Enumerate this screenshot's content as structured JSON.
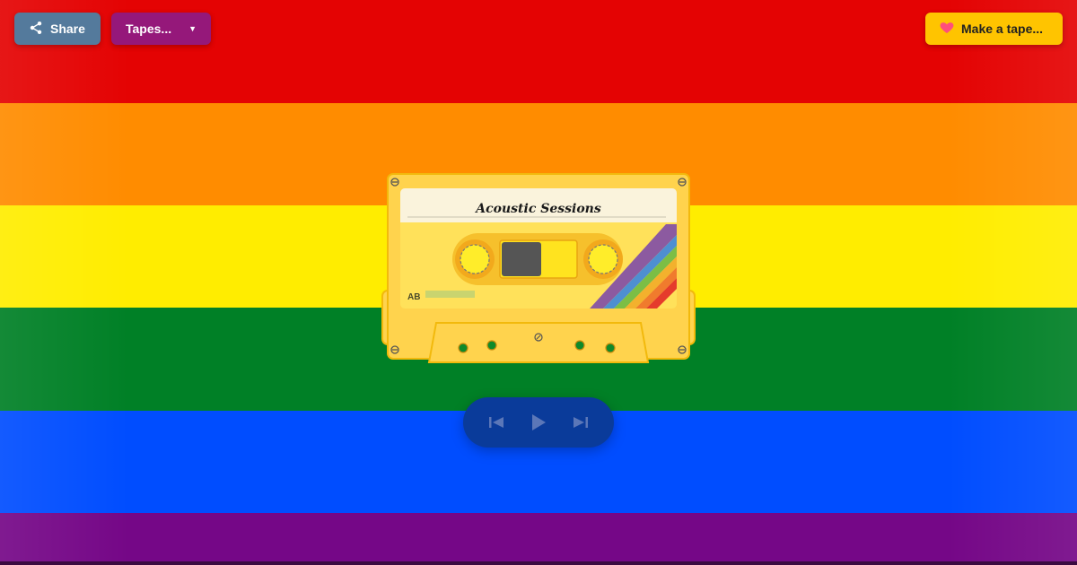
{
  "background": {
    "stripe_colors": [
      "#e40303",
      "#ff8c00",
      "#ffed00",
      "#008026",
      "#004dff",
      "#750787"
    ]
  },
  "header": {
    "share_label": "Share",
    "tapes_label": "Tapes...",
    "make_tape_label": "Make a tape..."
  },
  "colors": {
    "share_bg": "#547a9c",
    "tapes_bg": "#95187a",
    "make_bg": "#ffc400",
    "heart": "#ff4f7b",
    "cassette_body": "#ffd34d",
    "cassette_edge": "#f2b90c",
    "label_paper": "#faf3dc",
    "controls_bg": "#0a3b9a",
    "controls_icon": "#5b77b8"
  },
  "cassette": {
    "title": "Acoustic Sessions",
    "side_label": "AB",
    "rainbow_colors": [
      "#e53b2c",
      "#f07b2d",
      "#f3b12d",
      "#7cbe45",
      "#4e8fd1",
      "#8c5aa0"
    ]
  },
  "icons": {
    "share": "share-icon",
    "tapes_caret": "chevron-down-icon",
    "heart": "heart-icon",
    "prev": "skip-previous-icon",
    "play": "play-icon",
    "next": "skip-next-icon"
  }
}
